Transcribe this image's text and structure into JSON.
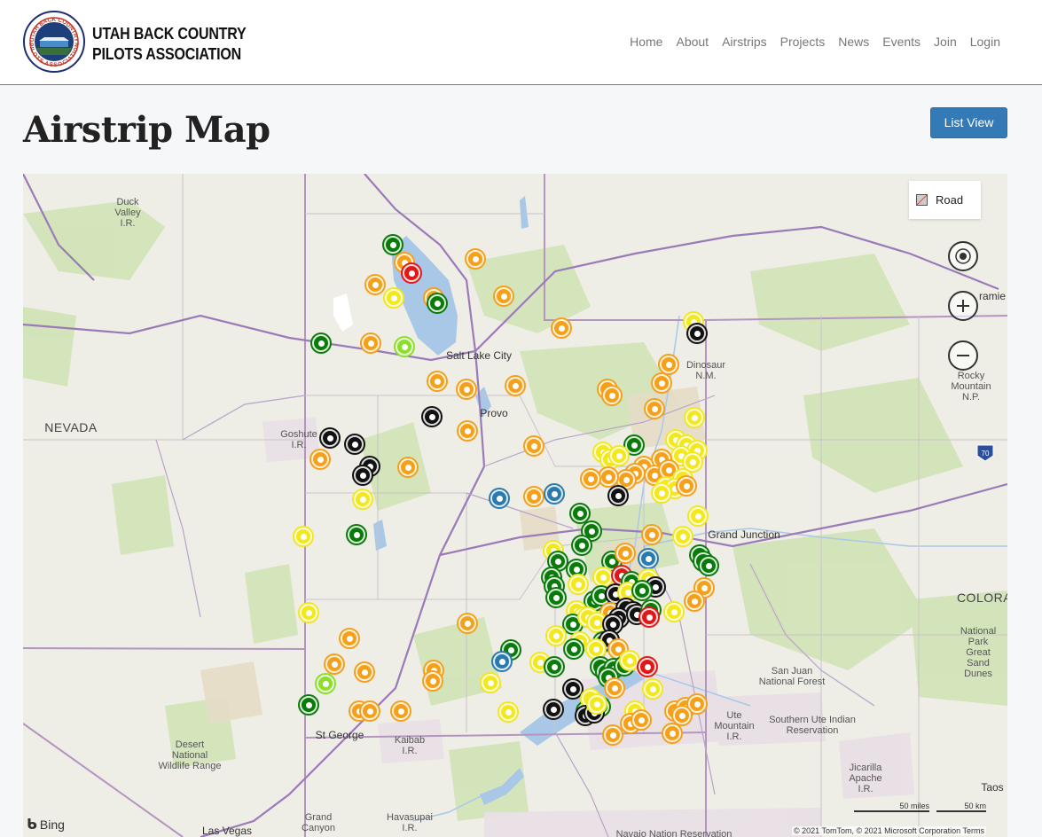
{
  "header": {
    "brand_line1": "UTAH BACK COUNTRY",
    "brand_line2": "PILOTS ASSOCIATION",
    "logo_ring_top": "UTAH BACK COUNTRY",
    "logo_ring_bottom": "PILOTS ASSOCIATION",
    "nav": [
      "Home",
      "About",
      "Airstrips",
      "Projects",
      "News",
      "Events",
      "Join",
      "Login"
    ]
  },
  "page": {
    "title": "Airstrip Map",
    "list_view_label": "List View"
  },
  "map": {
    "road_label": "Road",
    "labels": [
      {
        "text": "Duck\nValley\nI.R.",
        "kind": "area"
      },
      {
        "text": "Salt Lake City",
        "kind": "city"
      },
      {
        "text": "Provo",
        "kind": "city"
      },
      {
        "text": "NEVADA",
        "kind": "state"
      },
      {
        "text": "Goshute\nI.R.",
        "kind": "area"
      },
      {
        "text": "Dinosaur\nN.M.",
        "kind": "area"
      },
      {
        "text": "Rocky\nMountain\nN.P.",
        "kind": "area"
      },
      {
        "text": "ramie",
        "kind": "city"
      },
      {
        "text": "Grand Junction",
        "kind": "city"
      },
      {
        "text": "COLORA",
        "kind": "state"
      },
      {
        "text": "National\nPark\nGreat\nSand\nDunes",
        "kind": "area"
      },
      {
        "text": "San Juan\nNational Forest",
        "kind": "area"
      },
      {
        "text": "Ute\nMountain\nI.R.",
        "kind": "area"
      },
      {
        "text": "Southern Ute Indian\nReservation",
        "kind": "area"
      },
      {
        "text": "St George",
        "kind": "city"
      },
      {
        "text": "Kaibab\nI.R.",
        "kind": "area"
      },
      {
        "text": "Desert\nNational\nWildlife Range",
        "kind": "area"
      },
      {
        "text": "Jicarilla\nApache\nI.R.",
        "kind": "area"
      },
      {
        "text": "Taos",
        "kind": "city"
      },
      {
        "text": "Grand\nCanyon",
        "kind": "area"
      },
      {
        "text": "Havasupai\nI.R.",
        "kind": "area"
      },
      {
        "text": "Las Vegas",
        "kind": "city"
      },
      {
        "text": "Navajo Nation Reservation",
        "kind": "area"
      },
      {
        "text": "70",
        "kind": "shield"
      }
    ],
    "scale_miles": "50 miles",
    "scale_km": "50 km",
    "bing_label": "Bing",
    "copyright": "© 2021 TomTom, © 2021 Microsoft Corporation  Terms",
    "pin_colors": {
      "green": "#0a7a0a",
      "orange": "#f5a01a",
      "yellow": "#f3e81e",
      "black": "#111111",
      "red": "#e01818",
      "blue": "#2a7ab0",
      "lightgreen": "#8be02a"
    }
  }
}
